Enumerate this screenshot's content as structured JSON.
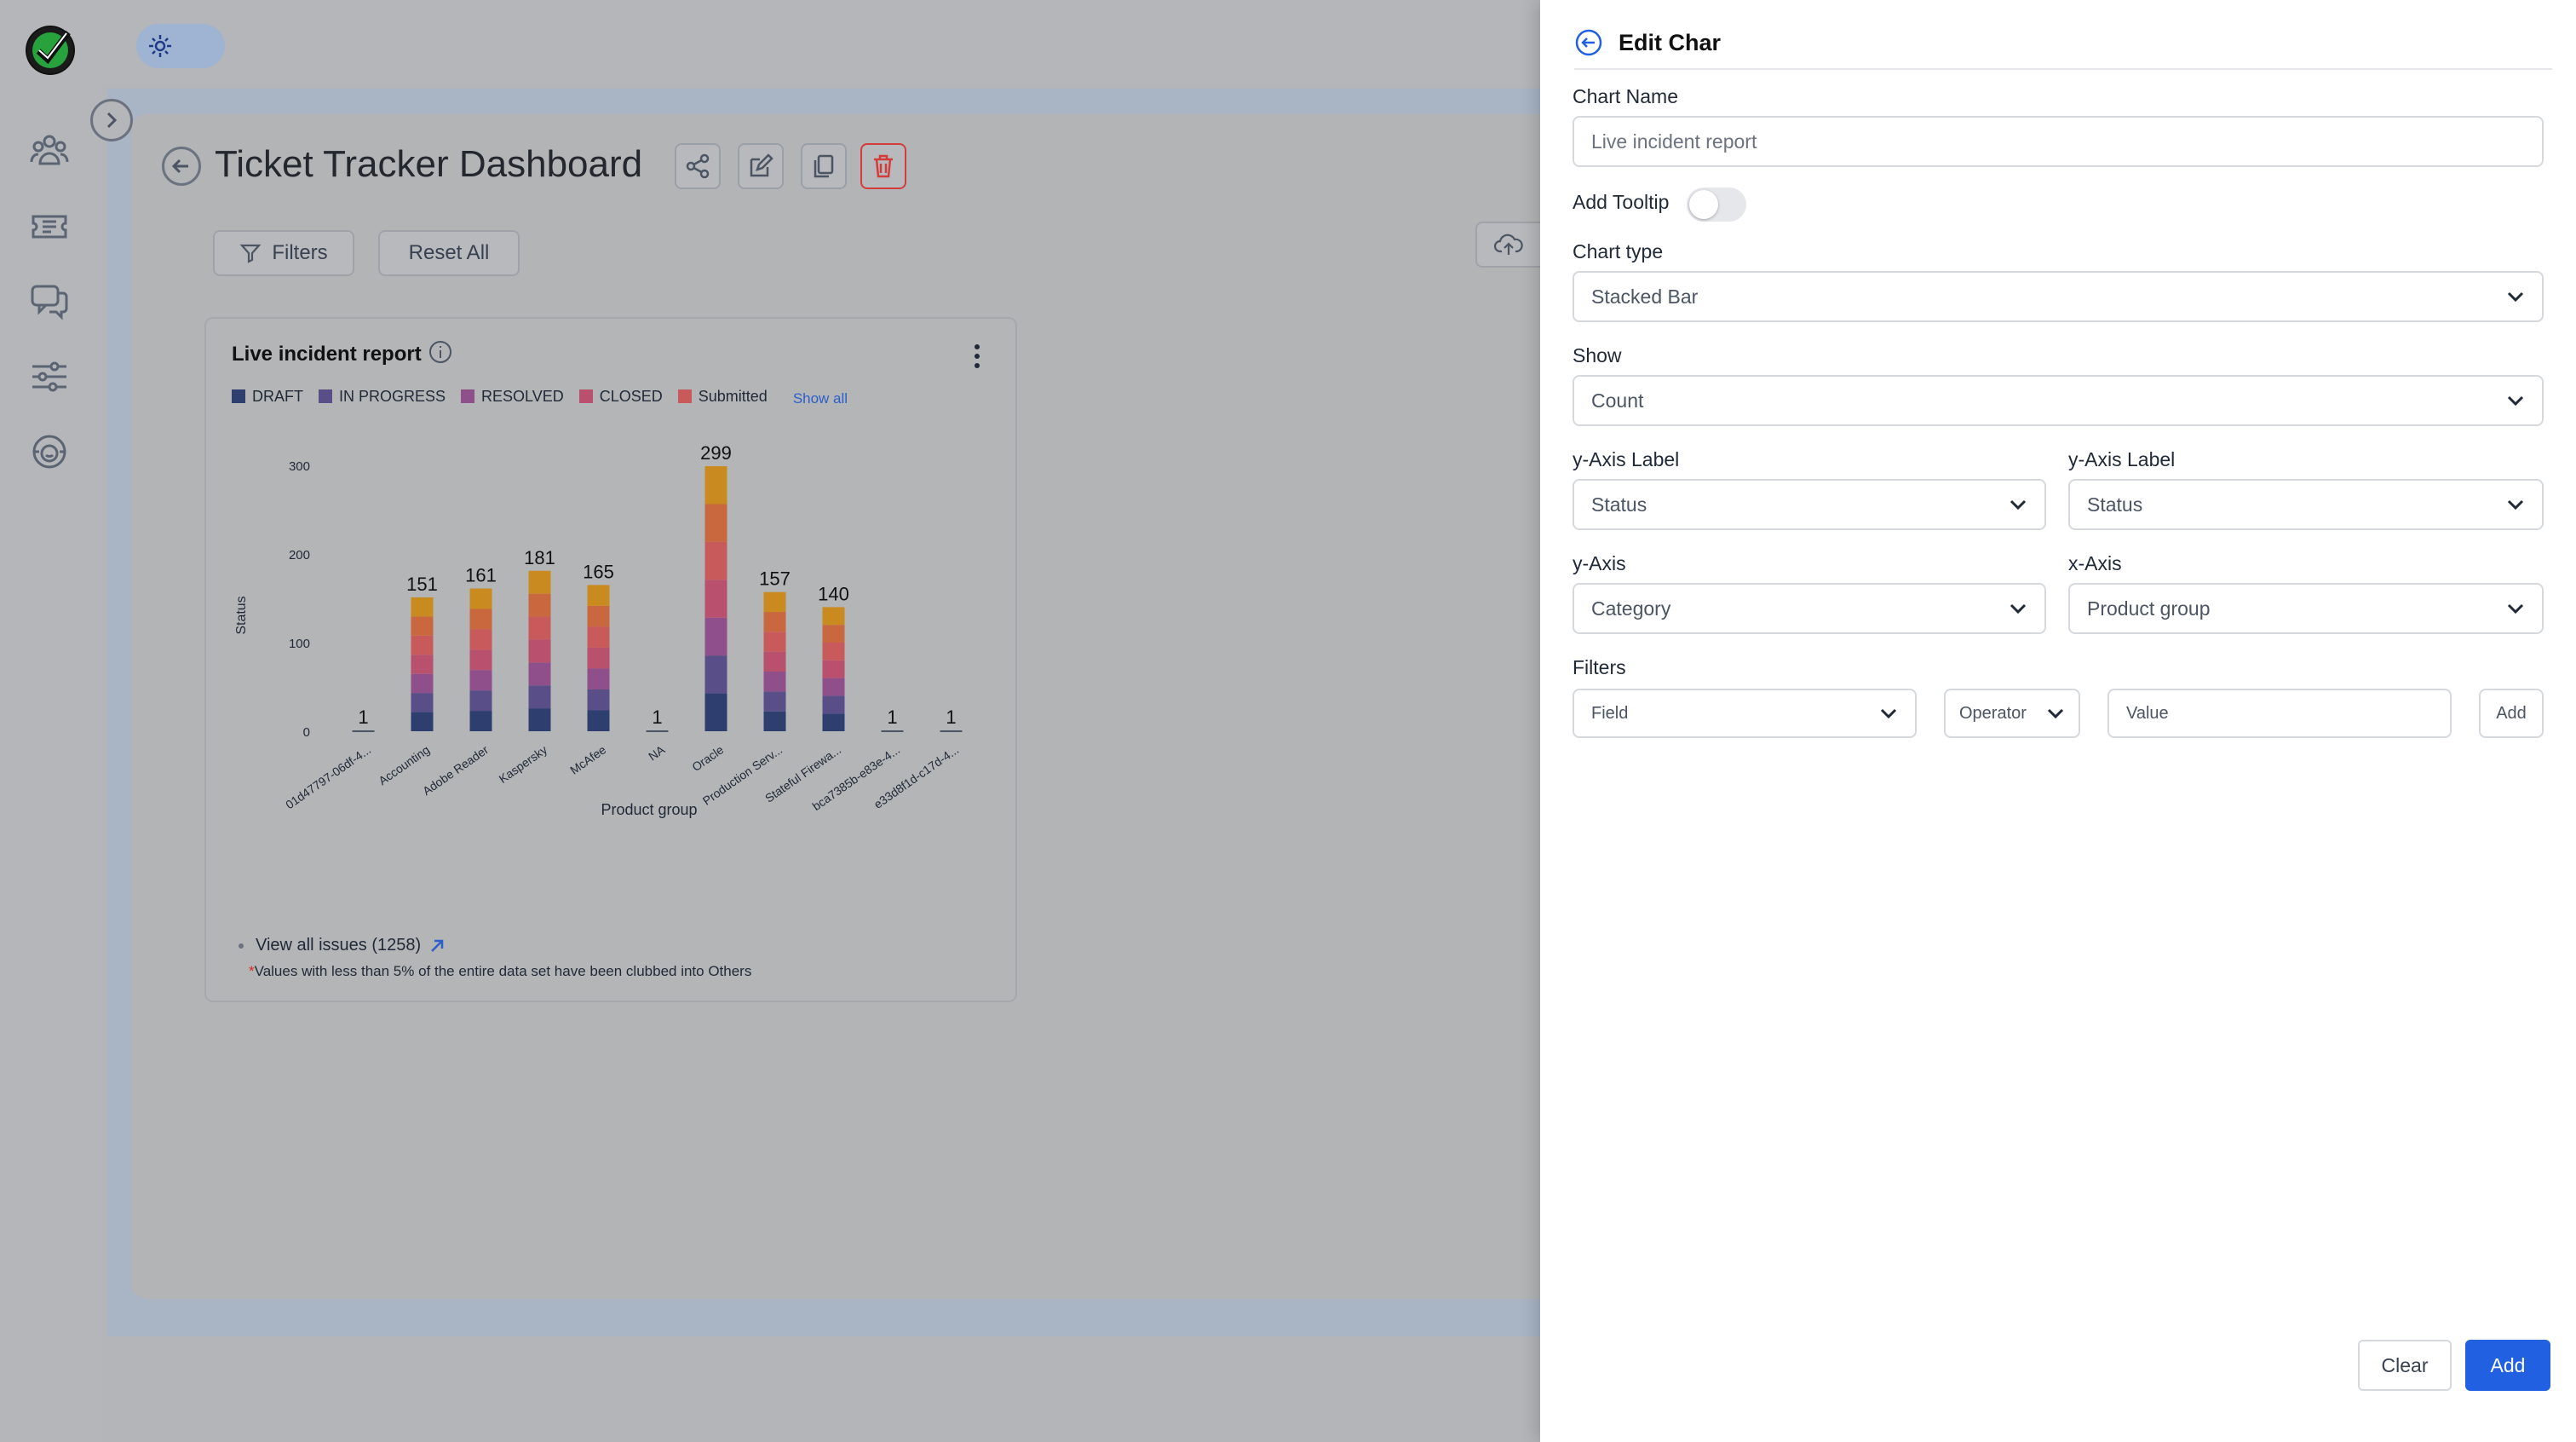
{
  "sidebar": {
    "logo": "checkmark-logo",
    "items": [
      {
        "icon": "users-icon"
      },
      {
        "icon": "ticket-icon"
      },
      {
        "icon": "chat-icon"
      },
      {
        "icon": "sliders-icon"
      },
      {
        "icon": "support-agent-icon"
      }
    ]
  },
  "theme_toggle": {
    "icon": "sun-icon"
  },
  "dashboard": {
    "title": "Ticket Tracker Dashboard",
    "actions": [
      "share-icon",
      "edit-icon",
      "copy-icon",
      "trash-icon"
    ],
    "filters_label": "Filters",
    "reset_label": "Reset All"
  },
  "card": {
    "title": "Live incident report",
    "show_all": "Show all",
    "view_all": "View all issues (1258)",
    "note_star": "*",
    "note": "Values with less than 5% of the entire data set have been clubbed into Others"
  },
  "chart_data": {
    "type": "bar",
    "stacked": true,
    "ylabel": "Status",
    "xlabel": "Product group",
    "ylim": [
      0,
      300
    ],
    "yticks": [
      0,
      100,
      200,
      300
    ],
    "categories": [
      "01d47797-06df-4...",
      "Accounting",
      "Adobe Reader",
      "Kaspersky",
      "McAfee",
      "NA",
      "Oracle",
      "Production Serv...",
      "Stateful Firewa...",
      "bca7385b-e83e-4...",
      "e33d8f1d-c17d-4..."
    ],
    "totals": [
      1,
      151,
      161,
      181,
      165,
      1,
      299,
      157,
      140,
      1,
      1
    ],
    "legend": [
      {
        "name": "DRAFT",
        "color": "#2e3e6e"
      },
      {
        "name": "IN PROGRESS",
        "color": "#5a4e88"
      },
      {
        "name": "RESOLVED",
        "color": "#8f4f8a"
      },
      {
        "name": "CLOSED",
        "color": "#b8506e"
      },
      {
        "name": "Submitted",
        "color": "#c85a5c"
      }
    ],
    "stack_colors": [
      "#2e3e6e",
      "#5a4e88",
      "#8f4f8a",
      "#b8506e",
      "#c85a5c",
      "#c9683f",
      "#c98a1f"
    ],
    "grid": false,
    "legend_position": "top-left"
  },
  "panel": {
    "title": "Edit Char",
    "chart_name_label": "Chart Name",
    "chart_name_placeholder": "Live incident report",
    "tooltip_label": "Add Tooltip",
    "tooltip_on": false,
    "chart_type_label": "Chart type",
    "chart_type_value": "Stacked Bar",
    "show_label": "Show",
    "show_value": "Count",
    "y_axis_label_left": "y-Axis Label",
    "y_axis_label_left_value": "Status",
    "y_axis_label_right": "y-Axis Label",
    "y_axis_label_right_value": "Status",
    "y_axis_label": "y-Axis",
    "y_axis_value": "Category",
    "x_axis_label": "x-Axis",
    "x_axis_value": "Product group",
    "filters_label": "Filters",
    "field_placeholder": "Field",
    "operator_placeholder": "Operator",
    "value_placeholder": "Value",
    "add_filter": "Add",
    "clear_button": "Clear",
    "add_button": "Add",
    "accent": "#2160e0"
  }
}
